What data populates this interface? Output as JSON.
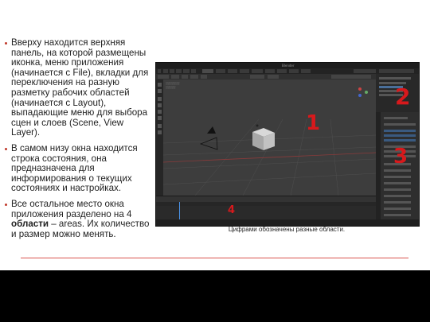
{
  "bullets": [
    {
      "text": "Вверху находится верхняя панель, на которой размещены иконка, меню приложения (начинается с File), вкладки для переключения на разную разметку рабочих областей (начинается с Layout), выпадающие меню для выбора сцен и слоев (Scene, View Layer)."
    },
    {
      "text": "В самом низу окна находится строка состояния, она предназначена для информирования о текущих состояниях и настройках."
    },
    {
      "text_before": "Все остальное место окна приложения разделено на 4 ",
      "text_bold": "области",
      "text_after": " – areas. Их количество и размер можно менять."
    }
  ],
  "screenshot": {
    "window_title": "Blender",
    "area_numbers": [
      "1",
      "2",
      "3",
      "4"
    ]
  },
  "caption": "Цифрами обозначены разные области.",
  "colors": {
    "accent_red": "#d7191c",
    "rule": "#d9534f",
    "footer": "#000000"
  }
}
